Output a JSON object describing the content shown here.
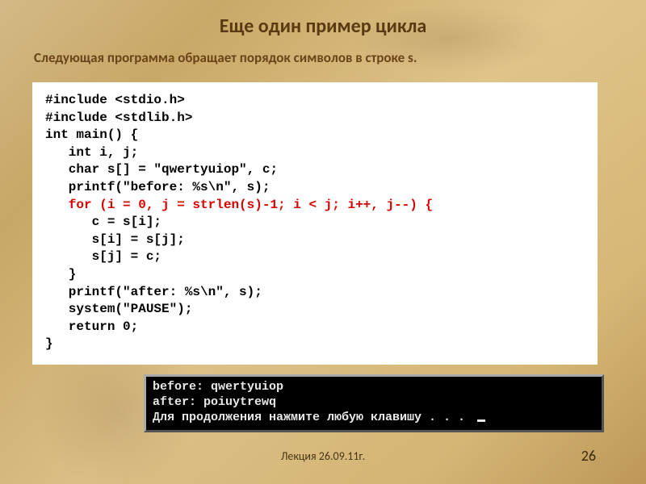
{
  "title": "Еще один пример цикла",
  "subtitle": "Следующая программа обращает порядок символов в строке s.",
  "code": {
    "l1": "#include <stdio.h>",
    "l2": "#include <stdlib.h>",
    "l3": "int main() {",
    "l4": "   int i, j;",
    "l5": "   char s[] = \"qwertyuiop\", c;",
    "l6": "   printf(\"before: %s\\n\", s);",
    "l7": "   for (i = 0, j = strlen(s)-1; i < j; i++, j--) {",
    "l8": "      c = s[i];",
    "l9": "      s[i] = s[j];",
    "l10": "      s[j] = c;",
    "l11": "   }",
    "l12": "   printf(\"after: %s\\n\", s);",
    "l13": "   system(\"PAUSE\");",
    "l14": "   return 0;",
    "l15": "}"
  },
  "console": {
    "l1": "before: qwertyuiop",
    "l2": "after: poiuytrewq",
    "l3": "Для продолжения нажмите любую клавишу . . . "
  },
  "footer": "Лекция  26.09.11г.",
  "page": "26"
}
